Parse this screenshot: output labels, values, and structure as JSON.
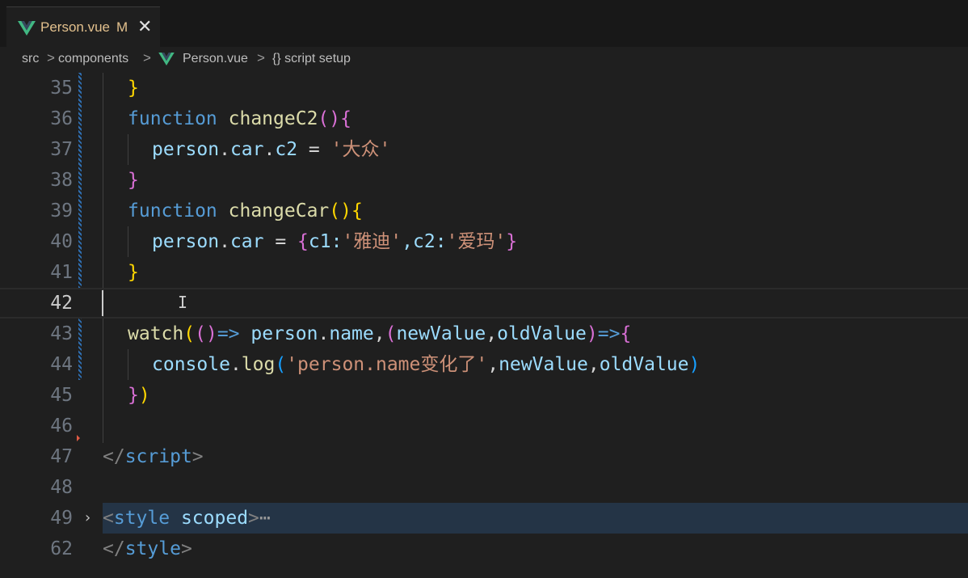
{
  "tab": {
    "title": "Person.vue",
    "badge": "M",
    "close": "✕",
    "icon": "vue-icon",
    "accent": "#e2c08d"
  },
  "breadcrumb": {
    "items": [
      "src",
      "components",
      "Person.vue",
      "{} script setup"
    ],
    "separator": ">"
  },
  "editor": {
    "current_line": "42",
    "lines": [
      {
        "n": "35"
      },
      {
        "n": "36"
      },
      {
        "n": "37"
      },
      {
        "n": "38"
      },
      {
        "n": "39"
      },
      {
        "n": "40"
      },
      {
        "n": "41"
      },
      {
        "n": "42"
      },
      {
        "n": "43"
      },
      {
        "n": "44"
      },
      {
        "n": "45"
      },
      {
        "n": "46"
      },
      {
        "n": "47"
      },
      {
        "n": "48"
      },
      {
        "n": "49"
      },
      {
        "n": "62"
      }
    ],
    "tokens": {
      "l35": [
        "}"
      ],
      "l36": [
        "function",
        " ",
        "changeC2",
        "(",
        ")",
        "{"
      ],
      "l37": [
        "person",
        ".",
        "car",
        ".",
        "c2",
        " = ",
        "'大众'"
      ],
      "l38": [
        "}"
      ],
      "l39": [
        "function",
        " ",
        "changeCar",
        "(",
        ")",
        "{"
      ],
      "l40": [
        "person",
        ".",
        "car",
        " = ",
        "{",
        "c1:",
        "'雅迪'",
        ",c2:",
        "'爱玛'",
        "}"
      ],
      "l41": [
        "}"
      ],
      "l43": [
        "watch",
        "(",
        "(",
        ")",
        "=>",
        " ",
        "person",
        ".",
        "name",
        ",",
        "(",
        "newValue",
        ",",
        "oldValue",
        ")",
        "=>",
        "{"
      ],
      "l44": [
        "console",
        ".",
        "log",
        "(",
        "'person.name变化了'",
        ",",
        "newValue",
        ",",
        "oldValue",
        ")"
      ],
      "l45": [
        "}",
        ")"
      ],
      "l47": [
        "</",
        "script",
        ">"
      ],
      "l49": [
        "<",
        "style",
        " scoped",
        ">",
        "⋯"
      ],
      "l62": [
        "</",
        "style",
        ">"
      ]
    }
  }
}
